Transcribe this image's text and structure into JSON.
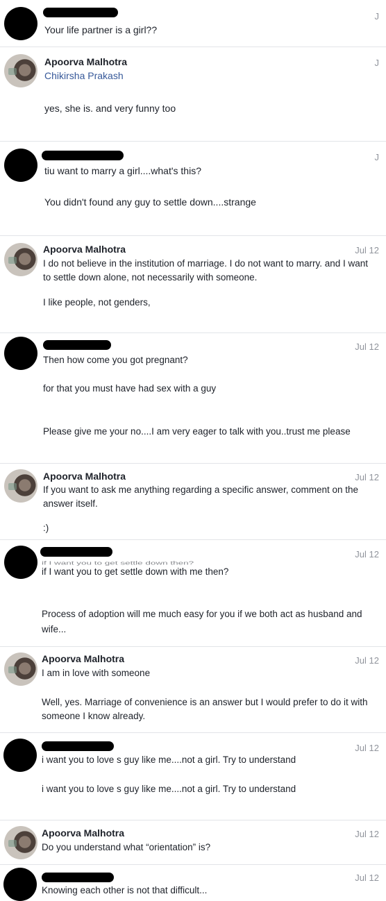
{
  "messages": [
    {
      "sender": "",
      "sender_redacted": true,
      "date": "J",
      "lines": [
        "Your life partner is a girl??"
      ]
    },
    {
      "sender": "Apoorva Malhotra",
      "subtitle": "Chikirsha Prakash",
      "date": "J",
      "lines": [
        "yes, she is. and very funny too"
      ]
    },
    {
      "sender": "",
      "sender_redacted": true,
      "date": "J",
      "lines": [
        "tiu want to marry a girl....what's this?",
        "You didn't found any guy to settle down....strange"
      ]
    },
    {
      "sender": "Apoorva Malhotra",
      "date": "Jul 12",
      "lines": [
        "I do not believe in the institution of marriage. I do not want to marry. and I want",
        "to settle down alone, not necessarily with someone.",
        "I like people, not genders,"
      ]
    },
    {
      "sender": "",
      "sender_redacted": true,
      "date": "Jul 12",
      "lines": [
        "Then how come you got pregnant?",
        "for that you must have had sex with a guy",
        "Please give me your no....I am very eager to talk with you..trust me please"
      ]
    },
    {
      "sender": "Apoorva Malhotra",
      "date": "Jul 12",
      "lines": [
        "If you want to ask me anything regarding a specific answer, comment on the",
        "answer itself.",
        ":)"
      ]
    },
    {
      "sender": "",
      "sender_redacted": true,
      "date": "Jul 12",
      "ghost": "if I want you to get settle down then?",
      "lines": [
        "if I want you to get settle down with me then?",
        "Process of adoption will me much easy for you if we both act as husband and",
        "wife..."
      ]
    },
    {
      "sender": "Apoorva Malhotra",
      "date": "Jul 12",
      "lines": [
        "I am in love with someone",
        "Well, yes. Marriage of convenience is an answer but I would prefer to do it with",
        "someone I know already."
      ]
    },
    {
      "sender": "",
      "sender_redacted": true,
      "date": "Jul 12",
      "lines": [
        "i want you to love s guy like me....not a girl. Try to understand",
        "i want you to love s guy like me....not a girl. Try to understand"
      ]
    },
    {
      "sender": "Apoorva Malhotra",
      "date": "Jul 12",
      "lines": [
        "Do you understand what “orientation” is?"
      ]
    },
    {
      "sender": "",
      "sender_redacted": true,
      "date": "Jul 12",
      "lines": [
        "Knowing each other is not that difficult..."
      ]
    }
  ]
}
